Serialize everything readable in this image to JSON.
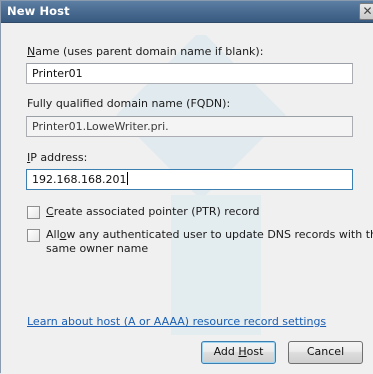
{
  "window": {
    "title": "New Host",
    "close_glyph": "✕"
  },
  "form": {
    "name_label_prefix": "",
    "name_label_access": "N",
    "name_label_rest": "ame (uses parent domain name if blank):",
    "name_value": "Printer01",
    "fqdn_label": "Fully qualified domain name (FQDN):",
    "fqdn_value": "Printer01.LoweWriter.pri.",
    "ip_label_access": "I",
    "ip_label_access2": "P",
    "ip_label_rest": " address:",
    "ip_value": "192.168.168.201",
    "ptr_checkbox_access": "C",
    "ptr_checkbox_rest": "reate associated pointer (PTR) record",
    "ptr_checked": false,
    "update_checkbox_pre": "All",
    "update_checkbox_access": "o",
    "update_checkbox_rest": "w any authenticated user to update DNS records with the",
    "update_checkbox_line2": "same owner name",
    "update_checked": false,
    "help_link": "Learn about host (A or AAAA) resource record settings"
  },
  "buttons": {
    "add_host_pre": "Add ",
    "add_host_access": "H",
    "add_host_rest": "ost",
    "cancel": "Cancel"
  },
  "colors": {
    "titlebar": "#47698f",
    "link": "#1a5fb4",
    "focus_border": "#3c7fb1"
  }
}
